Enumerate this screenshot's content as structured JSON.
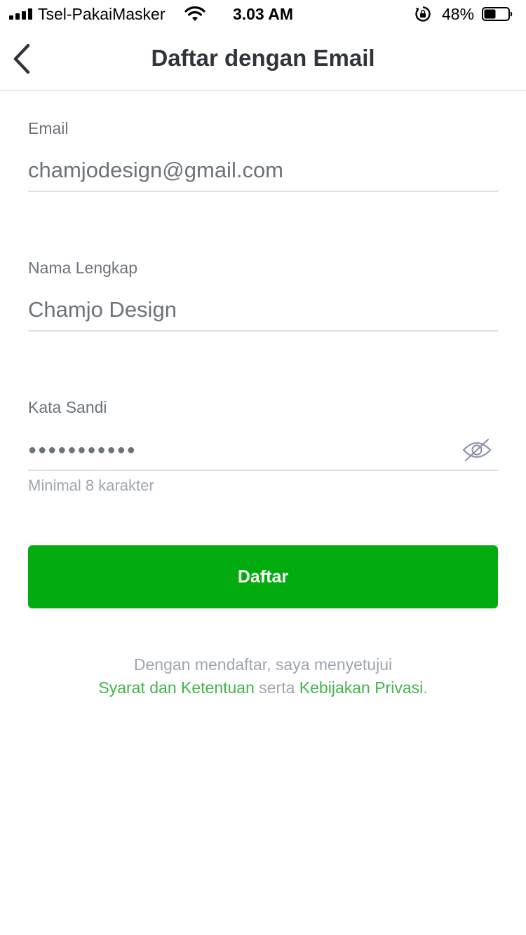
{
  "status_bar": {
    "carrier": "Tsel-PakaiMasker",
    "time": "3.03 AM",
    "battery": "48%",
    "battery_level": 0.48
  },
  "nav": {
    "title": "Daftar dengan Email"
  },
  "form": {
    "email": {
      "label": "Email",
      "value": "chamjodesign@gmail.com"
    },
    "name": {
      "label": "Nama Lengkap",
      "value": "Chamjo Design"
    },
    "password": {
      "label": "Kata Sandi",
      "masked_value": "●●●●●●●●●●●",
      "helper": "Minimal 8 karakter"
    },
    "submit_label": "Daftar"
  },
  "terms": {
    "line1": "Dengan mendaftar, saya menyetujui",
    "terms_link": "Syarat dan Ketentuan",
    "conjunction": "serta",
    "privacy_link": "Kebijakan Privasi",
    "period": "."
  },
  "colors": {
    "accent": "#03ac0e",
    "link": "#42b549"
  },
  "icons": {
    "back": "chevron-left-icon",
    "visibility": "eye-off-icon",
    "wifi": "wifi-icon",
    "rotation_lock": "rotation-lock-icon",
    "battery": "battery-icon",
    "signal": "signal-icon"
  }
}
